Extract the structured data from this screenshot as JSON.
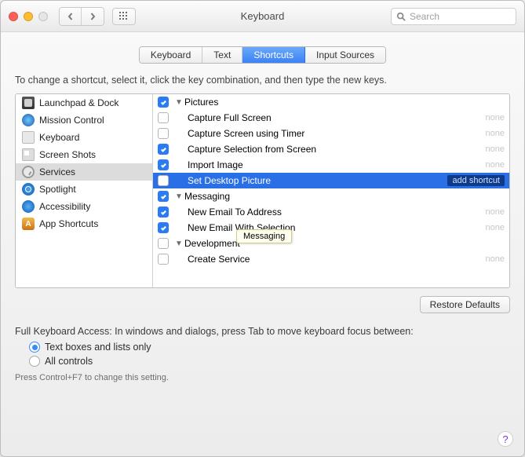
{
  "window": {
    "title": "Keyboard"
  },
  "search": {
    "placeholder": "Search"
  },
  "tabs": [
    {
      "label": "Keyboard",
      "id": "keyboard"
    },
    {
      "label": "Text",
      "id": "text"
    },
    {
      "label": "Shortcuts",
      "id": "shortcuts",
      "active": true
    },
    {
      "label": "Input Sources",
      "id": "input-sources"
    }
  ],
  "intro": "To change a shortcut, select it, click the key combination, and then type the new keys.",
  "categories": [
    {
      "label": "Launchpad & Dock",
      "icon": "launchpad-icon"
    },
    {
      "label": "Mission Control",
      "icon": "mission-control-icon"
    },
    {
      "label": "Keyboard",
      "icon": "keyboard-icon"
    },
    {
      "label": "Screen Shots",
      "icon": "screen-shots-icon"
    },
    {
      "label": "Services",
      "icon": "services-icon",
      "selected": true
    },
    {
      "label": "Spotlight",
      "icon": "spotlight-icon"
    },
    {
      "label": "Accessibility",
      "icon": "accessibility-icon"
    },
    {
      "label": "App Shortcuts",
      "icon": "app-shortcuts-icon"
    }
  ],
  "rows": [
    {
      "group": true,
      "checked": true,
      "label": "Pictures"
    },
    {
      "checked": false,
      "label": "Capture Full Screen",
      "shortcut": "none"
    },
    {
      "checked": false,
      "label": "Capture Screen using Timer",
      "shortcut": "none"
    },
    {
      "checked": true,
      "label": "Capture Selection from Screen",
      "shortcut": "none"
    },
    {
      "checked": true,
      "label": "Import Image",
      "shortcut": "none"
    },
    {
      "checked": false,
      "label": "Set Desktop Picture",
      "shortcut": "add shortcut",
      "selected": true
    },
    {
      "group": true,
      "checked": true,
      "label": "Messaging"
    },
    {
      "checked": true,
      "label": "New Email To Address",
      "shortcut": "none"
    },
    {
      "checked": true,
      "label": "New Email With Selection",
      "shortcut": "none"
    },
    {
      "group": true,
      "checked": false,
      "label": "Development"
    },
    {
      "checked": false,
      "label": "Create Service",
      "shortcut": "none"
    }
  ],
  "tooltip": "Messaging",
  "restore": "Restore Defaults",
  "fka": {
    "label": "Full Keyboard Access: In windows and dialogs, press Tab to move keyboard focus between:",
    "opt1": "Text boxes and lists only",
    "opt2": "All controls",
    "hint": "Press Control+F7 to change this setting."
  }
}
